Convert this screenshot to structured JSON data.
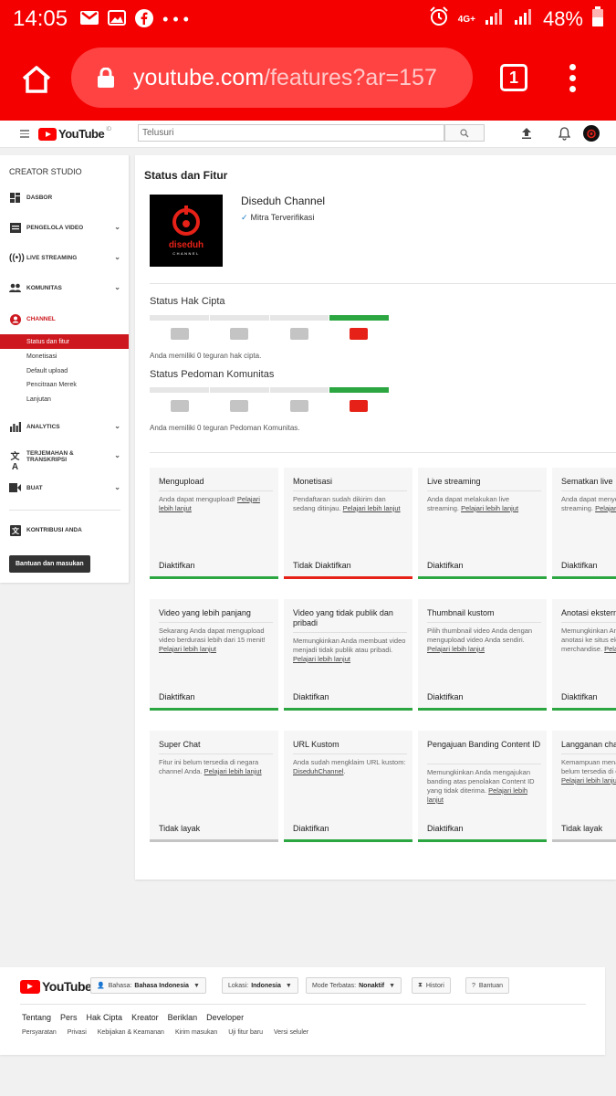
{
  "statusbar": {
    "time": "14:05",
    "network": "4G+",
    "battery": "48%"
  },
  "browser": {
    "url_host": "youtube.com",
    "url_path": "/features?ar=157",
    "tab_count": "1"
  },
  "header": {
    "logo_text": "YouTube",
    "logo_superscript": "ID",
    "search_placeholder": "Telusuri"
  },
  "sidebar": {
    "title": "CREATOR STUDIO",
    "items": [
      {
        "label": "DASBOR",
        "icon": "dashboard-icon"
      },
      {
        "label": "PENGELOLA VIDEO",
        "icon": "video-manager-icon"
      },
      {
        "label": "LIVE STREAMING",
        "icon": "live-icon"
      },
      {
        "label": "KOMUNITAS",
        "icon": "community-icon"
      },
      {
        "label": "CHANNEL",
        "icon": "channel-icon"
      },
      {
        "label": "ANALYTICS",
        "icon": "analytics-icon"
      },
      {
        "label": "TERJEMAHAN & TRANSKRIPSI",
        "icon": "translate-icon"
      },
      {
        "label": "BUAT",
        "icon": "create-icon"
      },
      {
        "label": "KONTRIBUSI ANDA",
        "icon": "contribution-icon"
      }
    ],
    "channel_sub": [
      "Status dan fitur",
      "Monetisasi",
      "Default upload",
      "Pencitraan Merek",
      "Lanjutan"
    ],
    "feedback_button": "Bantuan dan masukan"
  },
  "main": {
    "title": "Status dan Fitur",
    "channel_name": "Diseduh Channel",
    "verified": "Mitra Terverifikasi",
    "thumb_text1": "diseduh",
    "thumb_text2": "CHANNEL",
    "copyright": {
      "title": "Status Hak Cipta",
      "text": "Anda memiliki 0 teguran hak cipta."
    },
    "community": {
      "title": "Status Pedoman Komunitas",
      "text": "Anda memiliki 0 teguran Pedoman Komunitas."
    },
    "cards": [
      {
        "title": "Mengupload",
        "desc": "Anda dapat mengupload! ",
        "link": "Pelajari lebih lanjut",
        "status": "Diaktifkan",
        "state": "ok"
      },
      {
        "title": "Monetisasi",
        "desc": "Pendaftaran sudah dikirim dan sedang ditinjau. ",
        "link": "Pelajari lebih lanjut",
        "status": "Tidak Diaktifkan",
        "state": "bad"
      },
      {
        "title": "Live streaming",
        "desc": "Anda dapat melakukan live streaming. ",
        "link": "Pelajari lebih lanjut",
        "status": "Diaktifkan",
        "state": "ok"
      },
      {
        "title": "Sematkan live",
        "desc": "Anda dapat menyematkan live streaming. ",
        "link": "Pelajari lebih lanjut",
        "status": "Diaktifkan",
        "state": "ok"
      },
      {
        "title": "Video yang lebih panjang",
        "desc": "Sekarang Anda dapat mengupload video berdurasi lebih dari 15 menit! ",
        "link": "Pelajari lebih lanjut",
        "status": "Diaktifkan",
        "state": "ok"
      },
      {
        "title": "Video yang tidak publik dan pribadi",
        "desc": "Memungkinkan Anda membuat video menjadi tidak publik atau pribadi. ",
        "link": "Pelajari lebih lanjut",
        "status": "Diaktifkan",
        "state": "ok"
      },
      {
        "title": "Thumbnail kustom",
        "desc": "Pilih thumbnail video Anda dengan mengupload video Anda sendiri. ",
        "link": "Pelajari lebih lanjut",
        "status": "Diaktifkan",
        "state": "ok"
      },
      {
        "title": "Anotasi eksternal",
        "desc": "Memungkinkan Anda menautkan anotasi ke situs eksternal partner merchandise. ",
        "link": "Pelajari lebih lanjut",
        "status": "Diaktifkan",
        "state": "ok"
      },
      {
        "title": "Super Chat",
        "desc": "Fitur ini belum tersedia di negara channel Anda. ",
        "link": "Pelajari lebih lanjut",
        "status": "Tidak layak",
        "state": "na"
      },
      {
        "title": "URL Kustom",
        "desc": "Anda sudah mengklaim URL kustom: ",
        "link": "DiseduhChannel",
        "status": "Diaktifkan",
        "state": "ok"
      },
      {
        "title": "Pengajuan Banding Content ID",
        "desc": "Memungkinkan Anda mengajukan banding atas penolakan Content ID yang tidak diterima. ",
        "link": "Pelajari lebih lanjut",
        "status": "Diaktifkan",
        "state": "ok"
      },
      {
        "title": "Langganan channel",
        "desc": "Kemampuan menawarkan langganan belum tersedia di channel Anda. ",
        "link": "Pelajari lebih lanjut",
        "status": "Tidak layak",
        "state": "na"
      }
    ]
  },
  "footer": {
    "logo_text": "YouTube",
    "language_label": "Bahasa:",
    "language_value": "Bahasa Indonesia",
    "location_label": "Lokasi:",
    "location_value": "Indonesia",
    "restricted_label": "Mode Terbatas:",
    "restricted_value": "Nonaktif",
    "history": "Histori",
    "help": "Bantuan",
    "links1": [
      "Tentang",
      "Pers",
      "Hak Cipta",
      "Kreator",
      "Beriklan",
      "Developer"
    ],
    "links2": [
      "Persyaratan",
      "Privasi",
      "Kebijakan & Keamanan",
      "Kirim masukan",
      "Uji fitur baru",
      "Versi seluler"
    ]
  },
  "colors": {
    "brand_red": "#f40000",
    "yt_red": "#ff0000",
    "ok_green": "#2ba640",
    "bad_red": "#e62117",
    "active_nav": "#cc181e"
  }
}
